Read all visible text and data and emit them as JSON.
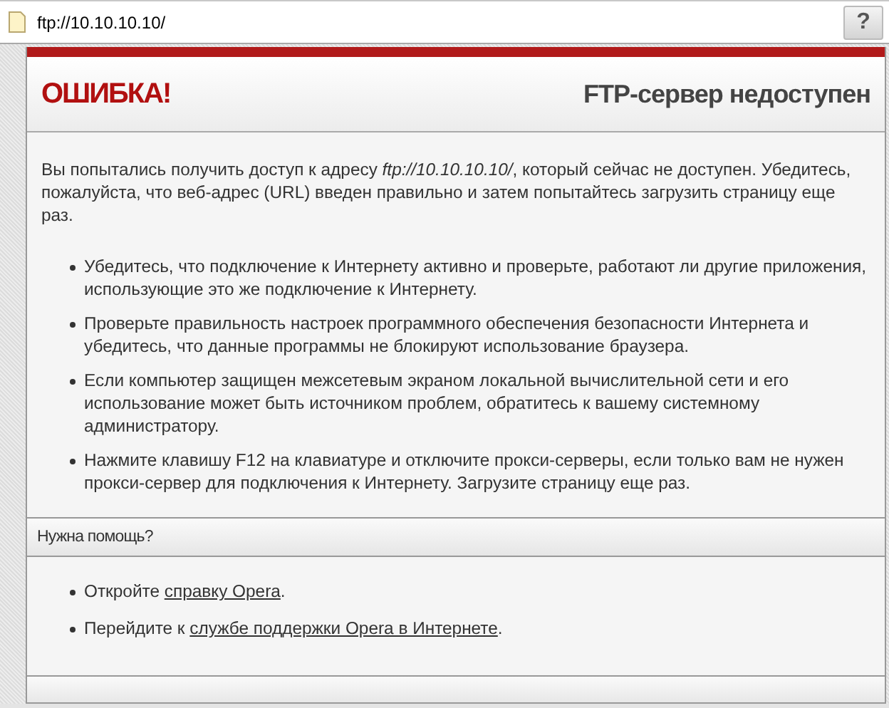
{
  "address_bar": {
    "url": "ftp://10.10.10.10/",
    "help_button": "?"
  },
  "error": {
    "title": "ОШИБКА!",
    "heading": "FTP-сервер недоступен",
    "message": "Вы попытались получить доступ к адресу *ftp://10.10.10.10/*, который сейчас не доступен. Убедитесь, пожалуйста, что веб-адрес (URL) введен правильно и затем попытайтесь загрузить страницу еще раз.",
    "tips": [
      "Убедитесь, что подключение к Интернету активно и проверьте, работают ли другие приложения, использующие это же подключение к Интернету.",
      "Проверьте правильность настроек программного обеспечения безопасности Интернета и убедитесь, что данные программы не блокируют использование браузера.",
      "Если компьютер защищен межсетевым экраном локальной вычислительной сети и его использование может быть источником проблем, обратитесь к вашему системному администратору.",
      "Нажмите клавишу F12 на клавиатуре и отключите прокси-серверы, если только вам не нужен прокси-сервер для подключения к Интернету. Загрузите страницу еще раз."
    ]
  },
  "help": {
    "title": "Нужна помощь?",
    "items": [
      {
        "before": "Откройте ",
        "link": "справку Opera",
        "after": "."
      },
      {
        "before": "Перейдите к ",
        "link": "службе поддержки Opera в Интернете",
        "after": "."
      }
    ]
  }
}
